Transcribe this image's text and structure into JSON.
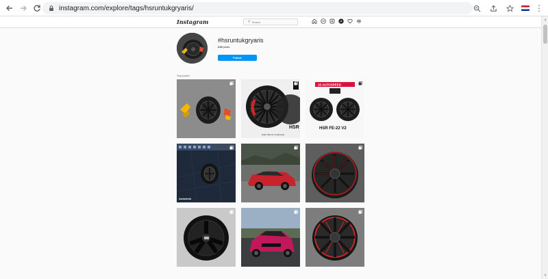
{
  "browser": {
    "url_host": "instagram.com",
    "url_path": "/explore/tags/hsruntukgryaris/"
  },
  "header": {
    "logo": "Instagram",
    "search_placeholder": "Search"
  },
  "tag": {
    "name": "#hsruntukgryaris",
    "posts_count": "219",
    "posts_label": "posts",
    "follow_label": "Follow"
  },
  "section": {
    "top_posts_label": "Top posts"
  },
  "tiles": [
    {
      "name": "post-wheel-yellow-calipers",
      "multi": true
    },
    {
      "name": "post-wheel-hsr-catalog",
      "multi": true
    },
    {
      "name": "post-wheel-hsr-fe22",
      "multi": true
    },
    {
      "name": "post-wheel-cad-render",
      "multi": true
    },
    {
      "name": "post-red-car",
      "multi": true
    },
    {
      "name": "post-wheel-red-stripe",
      "multi": true
    },
    {
      "name": "post-wheel-five-spoke",
      "multi": true
    },
    {
      "name": "post-pink-car",
      "multi": true
    },
    {
      "name": "post-wheel-red-lip",
      "multi": true
    }
  ],
  "tile_texts": {
    "hsr_logo": "HSR",
    "hsr_footer": "HSR TRP-01 CONCAVE",
    "fe22_banner": "15 AUTOSPEED",
    "fe22_title": "HSR FE-22 V2",
    "cad_title": "Autodesk"
  },
  "colors": {
    "accent": "#0095f6",
    "text": "#262626"
  }
}
